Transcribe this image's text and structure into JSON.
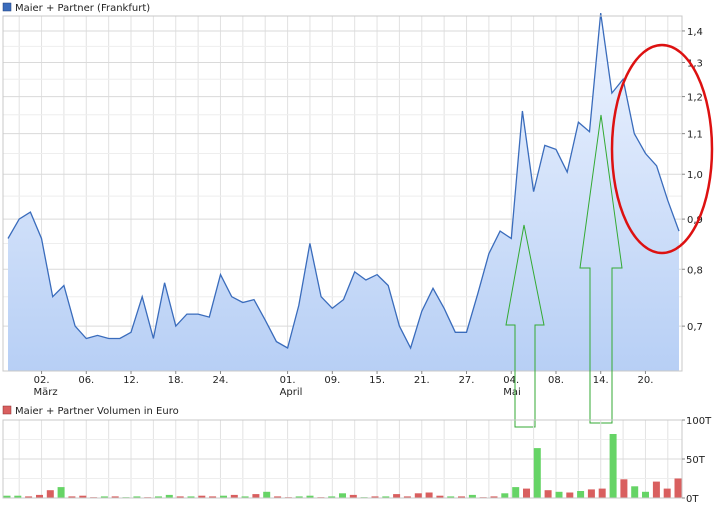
{
  "chart_data": [
    {
      "type": "area",
      "legend": "Maier + Partner (Frankfurt)",
      "series_color": "#3a6cbc",
      "y_ticks": [
        "1,4",
        "1,3",
        "1,2",
        "1,1",
        "1,0",
        "0,9",
        "0,8",
        "0,7"
      ],
      "y_tick_values": [
        1.4,
        1.3,
        1.2,
        1.1,
        1.0,
        0.9,
        0.8,
        0.7
      ],
      "ylim": [
        0.63,
        1.45
      ],
      "y_scale": "log",
      "x_ticks": [
        {
          "label": "02.",
          "sub": "März",
          "index": 3
        },
        {
          "label": "06.",
          "sub": "",
          "index": 7
        },
        {
          "label": "12.",
          "sub": "",
          "index": 11
        },
        {
          "label": "18.",
          "sub": "",
          "index": 15
        },
        {
          "label": "24.",
          "sub": "",
          "index": 19
        },
        {
          "label": "01.",
          "sub": "April",
          "index": 25
        },
        {
          "label": "09.",
          "sub": "",
          "index": 29
        },
        {
          "label": "15.",
          "sub": "",
          "index": 33
        },
        {
          "label": "21.",
          "sub": "",
          "index": 37
        },
        {
          "label": "27.",
          "sub": "",
          "index": 41
        },
        {
          "label": "04.",
          "sub": "Mai",
          "index": 45
        },
        {
          "label": "08.",
          "sub": "",
          "index": 49
        },
        {
          "label": "14.",
          "sub": "",
          "index": 53
        },
        {
          "label": "20.",
          "sub": "",
          "index": 57
        }
      ],
      "values": [
        0.86,
        0.9,
        0.915,
        0.86,
        0.75,
        0.77,
        0.7,
        0.68,
        0.685,
        0.68,
        0.68,
        0.69,
        0.75,
        0.68,
        0.775,
        0.7,
        0.72,
        0.72,
        0.715,
        0.79,
        0.75,
        0.74,
        0.745,
        0.71,
        0.675,
        0.665,
        0.735,
        0.85,
        0.75,
        0.73,
        0.745,
        0.795,
        0.78,
        0.79,
        0.77,
        0.7,
        0.665,
        0.725,
        0.765,
        0.73,
        0.69,
        0.69,
        0.755,
        0.83,
        0.875,
        0.86,
        1.16,
        0.96,
        1.07,
        1.06,
        1.005,
        1.13,
        1.105,
        1.46,
        1.21,
        1.25,
        1.1,
        1.05,
        1.02,
        0.94,
        0.875
      ],
      "grid": true
    },
    {
      "type": "bar",
      "legend": "Maier + Partner Volumen in Euro",
      "y_ticks": [
        "100T",
        "50T",
        "0T"
      ],
      "y_tick_values": [
        100,
        50,
        0
      ],
      "ylim": [
        0,
        100
      ],
      "up_color": "#66d466",
      "down_color": "#d95f5f",
      "values": [
        3,
        3,
        2,
        4,
        10,
        14,
        2,
        3,
        1,
        2,
        2,
        1,
        2,
        1,
        2,
        4,
        2,
        2,
        3,
        2,
        3,
        4,
        2,
        5,
        8,
        2,
        1,
        2,
        3,
        1,
        2,
        6,
        4,
        1,
        2,
        2,
        5,
        2,
        6,
        7,
        3,
        2,
        2,
        4,
        1,
        2,
        6,
        14,
        12,
        64,
        10,
        8,
        7,
        9,
        11,
        12,
        82,
        24,
        15,
        8,
        21,
        12,
        25
      ],
      "directions": [
        "u",
        "u",
        "d",
        "d",
        "d",
        "u",
        "d",
        "d",
        "d",
        "u",
        "d",
        "u",
        "u",
        "d",
        "u",
        "u",
        "d",
        "u",
        "d",
        "d",
        "u",
        "d",
        "u",
        "d",
        "u",
        "d",
        "d",
        "u",
        "u",
        "d",
        "u",
        "u",
        "d",
        "u",
        "d",
        "u",
        "d",
        "d",
        "d",
        "d",
        "d",
        "u",
        "d",
        "u",
        "d",
        "d",
        "u",
        "u",
        "d",
        "u",
        "d",
        "u",
        "d",
        "u",
        "d",
        "d",
        "u",
        "d",
        "u",
        "u",
        "d",
        "d",
        "d"
      ],
      "grid": true
    }
  ]
}
